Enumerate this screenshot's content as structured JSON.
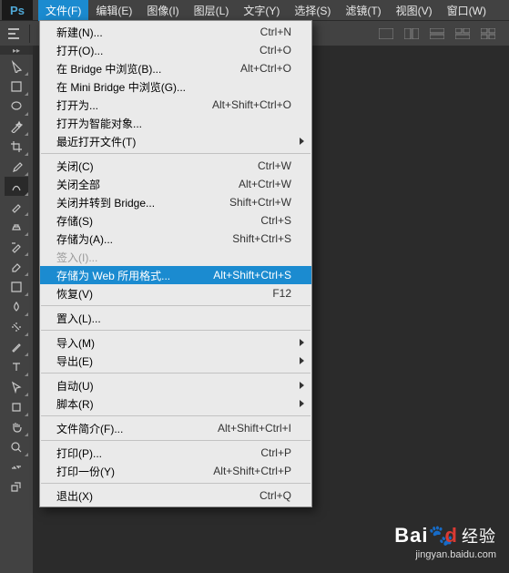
{
  "logo": "Ps",
  "menubar": [
    {
      "label": "文件(F)",
      "active": true
    },
    {
      "label": "编辑(E)"
    },
    {
      "label": "图像(I)"
    },
    {
      "label": "图层(L)"
    },
    {
      "label": "文字(Y)"
    },
    {
      "label": "选择(S)"
    },
    {
      "label": "滤镜(T)"
    },
    {
      "label": "视图(V)"
    },
    {
      "label": "窗口(W)"
    }
  ],
  "dropdown": [
    {
      "label": "新建(N)...",
      "shortcut": "Ctrl+N"
    },
    {
      "label": "打开(O)...",
      "shortcut": "Ctrl+O"
    },
    {
      "label": "在 Bridge 中浏览(B)...",
      "shortcut": "Alt+Ctrl+O"
    },
    {
      "label": "在 Mini Bridge 中浏览(G)..."
    },
    {
      "label": "打开为...",
      "shortcut": "Alt+Shift+Ctrl+O"
    },
    {
      "label": "打开为智能对象..."
    },
    {
      "label": "最近打开文件(T)",
      "submenu": true
    },
    {
      "sep": true
    },
    {
      "label": "关闭(C)",
      "shortcut": "Ctrl+W"
    },
    {
      "label": "关闭全部",
      "shortcut": "Alt+Ctrl+W"
    },
    {
      "label": "关闭并转到 Bridge...",
      "shortcut": "Shift+Ctrl+W"
    },
    {
      "label": "存储(S)",
      "shortcut": "Ctrl+S"
    },
    {
      "label": "存储为(A)...",
      "shortcut": "Shift+Ctrl+S"
    },
    {
      "label": "签入(I)...",
      "disabled": true
    },
    {
      "label": "存储为 Web 所用格式...",
      "shortcut": "Alt+Shift+Ctrl+S",
      "hl": true
    },
    {
      "label": "恢复(V)",
      "shortcut": "F12"
    },
    {
      "sep": true
    },
    {
      "label": "置入(L)..."
    },
    {
      "sep": true
    },
    {
      "label": "导入(M)",
      "submenu": true
    },
    {
      "label": "导出(E)",
      "submenu": true
    },
    {
      "sep": true
    },
    {
      "label": "自动(U)",
      "submenu": true
    },
    {
      "label": "脚本(R)",
      "submenu": true
    },
    {
      "sep": true
    },
    {
      "label": "文件简介(F)...",
      "shortcut": "Alt+Shift+Ctrl+I"
    },
    {
      "sep": true
    },
    {
      "label": "打印(P)...",
      "shortcut": "Ctrl+P"
    },
    {
      "label": "打印一份(Y)",
      "shortcut": "Alt+Shift+Ctrl+P"
    },
    {
      "sep": true
    },
    {
      "label": "退出(X)",
      "shortcut": "Ctrl+Q"
    }
  ],
  "tools": [
    "move",
    "marquee",
    "lasso",
    "magic-wand",
    "crop",
    "eyedropper",
    "healing-brush",
    "brush",
    "clone-stamp",
    "history-brush",
    "eraser",
    "gradient",
    "blur",
    "dodge",
    "pen",
    "type",
    "path-select",
    "rectangle",
    "hand",
    "zoom",
    "swap-colors",
    "foreground-background"
  ],
  "watermark": {
    "brand_a": "Bai",
    "brand_b": "d",
    "brand_c": "经验",
    "url": "jingyan.baidu.com"
  }
}
